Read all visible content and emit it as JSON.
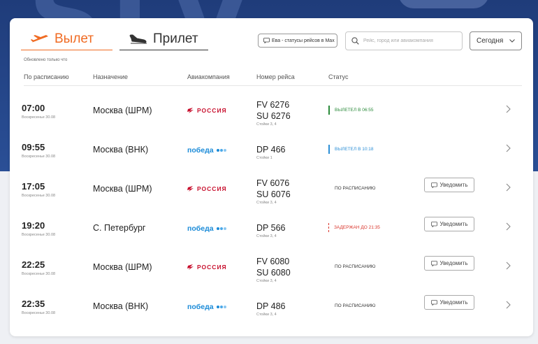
{
  "tabs": {
    "departure_label": "Вылет",
    "arrival_label": "Прилет",
    "updated_note": "Обновлено только что"
  },
  "controls": {
    "max_button_label": "Ева - статусы рейсов в Max",
    "search_placeholder": "Рейс, город или авиакомпания",
    "date_label": "Сегодня"
  },
  "table": {
    "headers": {
      "scheduled": "По расписанию",
      "destination": "Назначение",
      "airline": "Авиакомпания",
      "flight": "Номер рейса",
      "status": "Статус"
    },
    "notify_label": "Уведомить",
    "rows": [
      {
        "time": "07:00",
        "day": "Воскресенье 30.08",
        "destination": "Москва (ШРМ)",
        "airline": "rossiya",
        "flights": [
          "FV 6276",
          "SU 6276"
        ],
        "gate": "Стойки 3, 4",
        "status": "ВЫЛЕТЕЛ В 06:55",
        "status_type": "departed"
      },
      {
        "time": "09:55",
        "day": "Воскресенье 30.08",
        "destination": "Москва (ВНК)",
        "airline": "pobeda",
        "flights": [
          "DP 466"
        ],
        "gate": "Стойки 1",
        "status": "ВЫЛЕТЕЛ В 10:18",
        "status_type": "departed-blue"
      },
      {
        "time": "17:05",
        "day": "Воскресенье 30.08",
        "destination": "Москва (ШРМ)",
        "airline": "rossiya",
        "flights": [
          "FV 6076",
          "SU 6076"
        ],
        "gate": "Стойки 3, 4",
        "status": "ПО РАСПИСАНИЮ",
        "status_type": "scheduled"
      },
      {
        "time": "19:20",
        "day": "Воскресенье 30.08",
        "destination": "С. Петербург",
        "airline": "pobeda",
        "flights": [
          "DP 566"
        ],
        "gate": "Стойки 3, 4",
        "status": "ЗАДЕРЖАН ДО 21:35",
        "status_type": "delayed"
      },
      {
        "time": "22:25",
        "day": "Воскресенье 30.08",
        "destination": "Москва (ШРМ)",
        "airline": "rossiya",
        "flights": [
          "FV 6080",
          "SU 6080"
        ],
        "gate": "Стойки 3, 4",
        "status": "ПО РАСПИСАНИЮ",
        "status_type": "scheduled"
      },
      {
        "time": "22:35",
        "day": "Воскресенье 30.08",
        "destination": "Москва (ВНК)",
        "airline": "pobeda",
        "flights": [
          "DP 486"
        ],
        "gate": "Стойки 3, 4",
        "status": "ПО РАСПИСАНИЮ",
        "status_type": "scheduled"
      }
    ]
  },
  "airlines": {
    "rossiya": {
      "name": "РОССИЯ",
      "color": "#c8102e"
    },
    "pobeda": {
      "name": "победа",
      "color": "#1b8bd8",
      "dot_colors": [
        "#1b8bd8",
        "#4aa8e8",
        "#8cc7f0"
      ]
    }
  },
  "colors": {
    "accent": "#f06b23",
    "departed": "#2a8a3a",
    "departed_blue": "#2c8fd6",
    "delayed": "#d9342b"
  }
}
